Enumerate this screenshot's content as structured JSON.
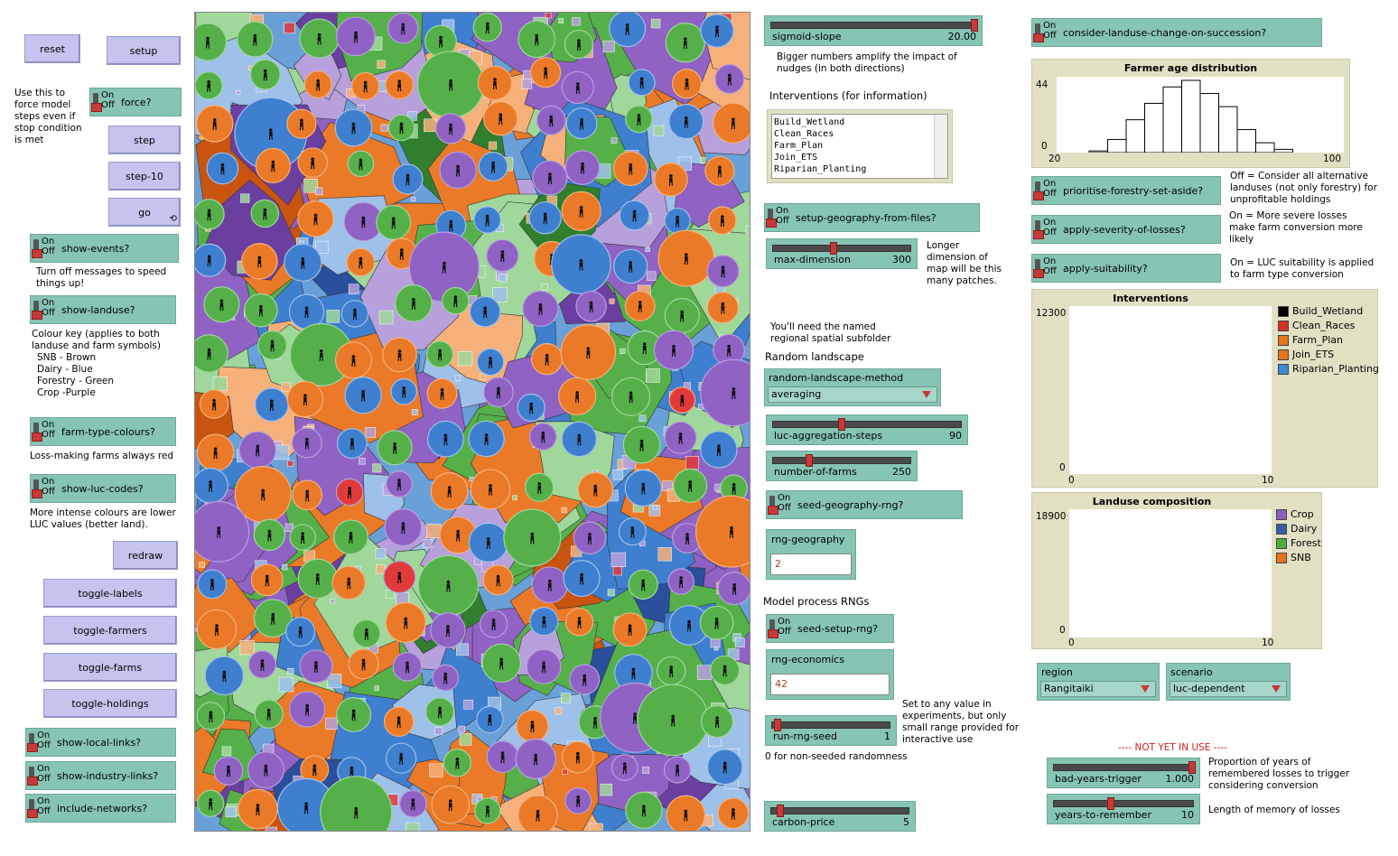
{
  "buttons": {
    "reset": "reset",
    "setup": "setup",
    "step": "step",
    "step10": "step-10",
    "go": "go",
    "redraw": "redraw",
    "toggle_labels": "toggle-labels",
    "toggle_farmers": "toggle-farmers",
    "toggle_farms": "toggle-farms",
    "toggle_holdings": "toggle-holdings"
  },
  "switch_text": {
    "on": "On",
    "off": "Off"
  },
  "switches": {
    "force": "force?",
    "show_events": "show-events?",
    "show_landuse": "show-landuse?",
    "farm_type_colours": "farm-type-colours?",
    "show_luc_codes": "show-luc-codes?",
    "show_local_links": "show-local-links?",
    "show_industry_links": "show-industry-links?",
    "include_networks": "include-networks?",
    "setup_geography_from_files": "setup-geography-from-files?",
    "seed_geography_rng": "seed-geography-rng?",
    "seed_setup_rng": "seed-setup-rng?",
    "consider_landuse_change": "consider-landuse-change-on-succession?",
    "prioritise_forestry": "prioritise-forestry-set-aside?",
    "apply_severity": "apply-severity-of-losses?",
    "apply_suitability": "apply-suitability?"
  },
  "notes": {
    "force_note": [
      "Use this to",
      "force model",
      "steps even if",
      "stop condition",
      "is met"
    ],
    "events_note": [
      "Turn off messages to speed",
      "things up!"
    ],
    "colour_key": [
      "Colour key (applies to both",
      "landuse and farm symbols)",
      "  SNB - Brown",
      "  Dairy - Blue",
      "  Forestry - Green",
      "  Crop -Purple"
    ],
    "lossmaking": "Loss-making farms always red",
    "luc_note": [
      "More intense colours are lower",
      "LUC values (better land)."
    ],
    "sigmoid_note": [
      "Bigger numbers amplify the impact of",
      "nudges (in both directions)"
    ],
    "interventions_info": "Interventions (for information)",
    "longer_dim": [
      "Longer",
      "dimension of",
      "map will be this",
      "many patches."
    ],
    "named_folder": [
      "You'll need the named",
      "regional spatial subfolder"
    ],
    "random_landscape": "Random landscape",
    "model_rngs": "Model process RNGs",
    "set_any": [
      "Set to any value in",
      "experiments, but only",
      "small range provided for",
      "interactive use"
    ],
    "non_seeded": "0 for non-seeded randomness",
    "prioritise_note": [
      "Off = Consider all alternative",
      "landuses (not only forestry) for",
      "unprofitable holdings"
    ],
    "severity_note": [
      "On = More severe losses",
      "make farm conversion more",
      "likely"
    ],
    "suitability_note": [
      "On = LUC suitability is applied",
      "to farm type conversion"
    ],
    "not_yet": "---- NOT YET IN USE ----",
    "proportion_note": [
      "Proportion of years of",
      "remembered losses to trigger",
      "considering conversion"
    ],
    "memory_note": "Length of memory of losses"
  },
  "sliders": {
    "sigmoid_slope": {
      "name": "sigmoid-slope",
      "value": "20.00",
      "frac": 1.0
    },
    "max_dimension": {
      "name": "max-dimension",
      "value": "300",
      "frac": 0.43
    },
    "luc_aggregation_steps": {
      "name": "luc-aggregation-steps",
      "value": "90",
      "frac": 0.36
    },
    "number_of_farms": {
      "name": "number-of-farms",
      "value": "250",
      "frac": 0.25
    },
    "run_rng_seed": {
      "name": "run-rng-seed",
      "value": "1",
      "frac": 0.02
    },
    "carbon_price": {
      "name": "carbon-price",
      "value": "5",
      "frac": 0.05
    },
    "bad_years_trigger": {
      "name": "bad-years-trigger",
      "value": "1.000",
      "frac": 1.0
    },
    "years_to_remember": {
      "name": "years-to-remember",
      "value": "10",
      "frac": 0.4
    }
  },
  "choosers": {
    "random_landscape_method": {
      "name": "random-landscape-method",
      "value": "averaging"
    },
    "region": {
      "name": "region",
      "value": "Rangitaiki"
    },
    "scenario": {
      "name": "scenario",
      "value": "luc-dependent"
    }
  },
  "inputs": {
    "rng_geography": {
      "name": "rng-geography",
      "value": "2"
    },
    "rng_economics": {
      "name": "rng-economics",
      "value": "42"
    }
  },
  "interventions_list": [
    "Build_Wetland",
    "Clean_Races",
    "Farm_Plan",
    "Join_ETS",
    "Riparian_Planting"
  ],
  "age_plot": {
    "title": "Farmer age distribution",
    "ymax_label": "44",
    "ymin_label": "0",
    "xmin_label": "20",
    "xmax_label": "100",
    "bins": [
      1,
      8,
      20,
      30,
      40,
      44,
      36,
      28,
      14,
      6,
      2
    ]
  },
  "interventions_plot": {
    "title": "Interventions",
    "ymax_label": "12300",
    "ymin_label": "0",
    "xmin_label": "0",
    "xmax_label": "10",
    "legend": [
      {
        "label": "Build_Wetland",
        "color": "#000000"
      },
      {
        "label": "Clean_Races",
        "color": "#d73027"
      },
      {
        "label": "Farm_Plan",
        "color": "#e8741e"
      },
      {
        "label": "Join_ETS",
        "color": "#e8741e"
      },
      {
        "label": "Riparian_Planting",
        "color": "#3d8bd0"
      }
    ]
  },
  "landuse_plot": {
    "title": "Landuse composition",
    "ymax_label": "18900",
    "ymin_label": "0",
    "xmin_label": "0",
    "xmax_label": "10",
    "legend": [
      {
        "label": "Crop",
        "color": "#8c5ebd"
      },
      {
        "label": "Dairy",
        "color": "#3b5ba8"
      },
      {
        "label": "Forest",
        "color": "#4caf3b"
      },
      {
        "label": "SNB",
        "color": "#e8711e"
      }
    ]
  },
  "landuse_colors": {
    "crop": "#8f62c4",
    "dairy": "#3f7fcf",
    "forest": "#55b04a",
    "snb": "#ea7a28",
    "loss": "#e23a3a"
  }
}
